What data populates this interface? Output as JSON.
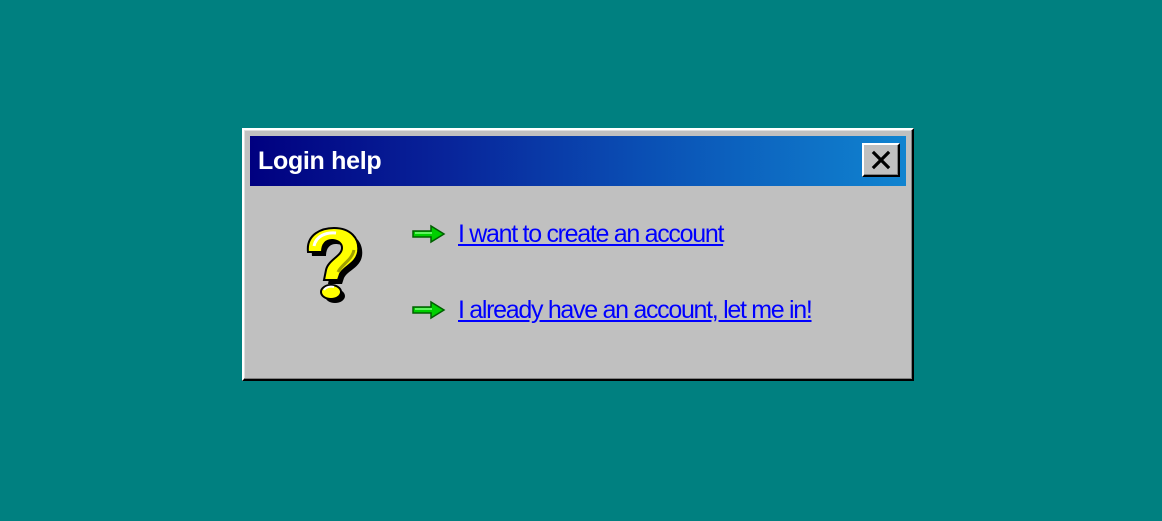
{
  "dialog": {
    "title": "Login help",
    "close_icon": "close-icon",
    "help_icon": "question-mark-icon",
    "links": [
      {
        "label": "I want to create an account",
        "icon": "arrow-right-icon"
      },
      {
        "label": "I already have an account, let me in!",
        "icon": "arrow-right-icon"
      }
    ]
  },
  "colors": {
    "desktop": "#008080",
    "dialog_face": "#c0c0c0",
    "titlebar_start": "#000080",
    "titlebar_end": "#1084d0",
    "link": "#0000ff",
    "arrow": "#00c000",
    "question_mark": "#ffff00"
  }
}
